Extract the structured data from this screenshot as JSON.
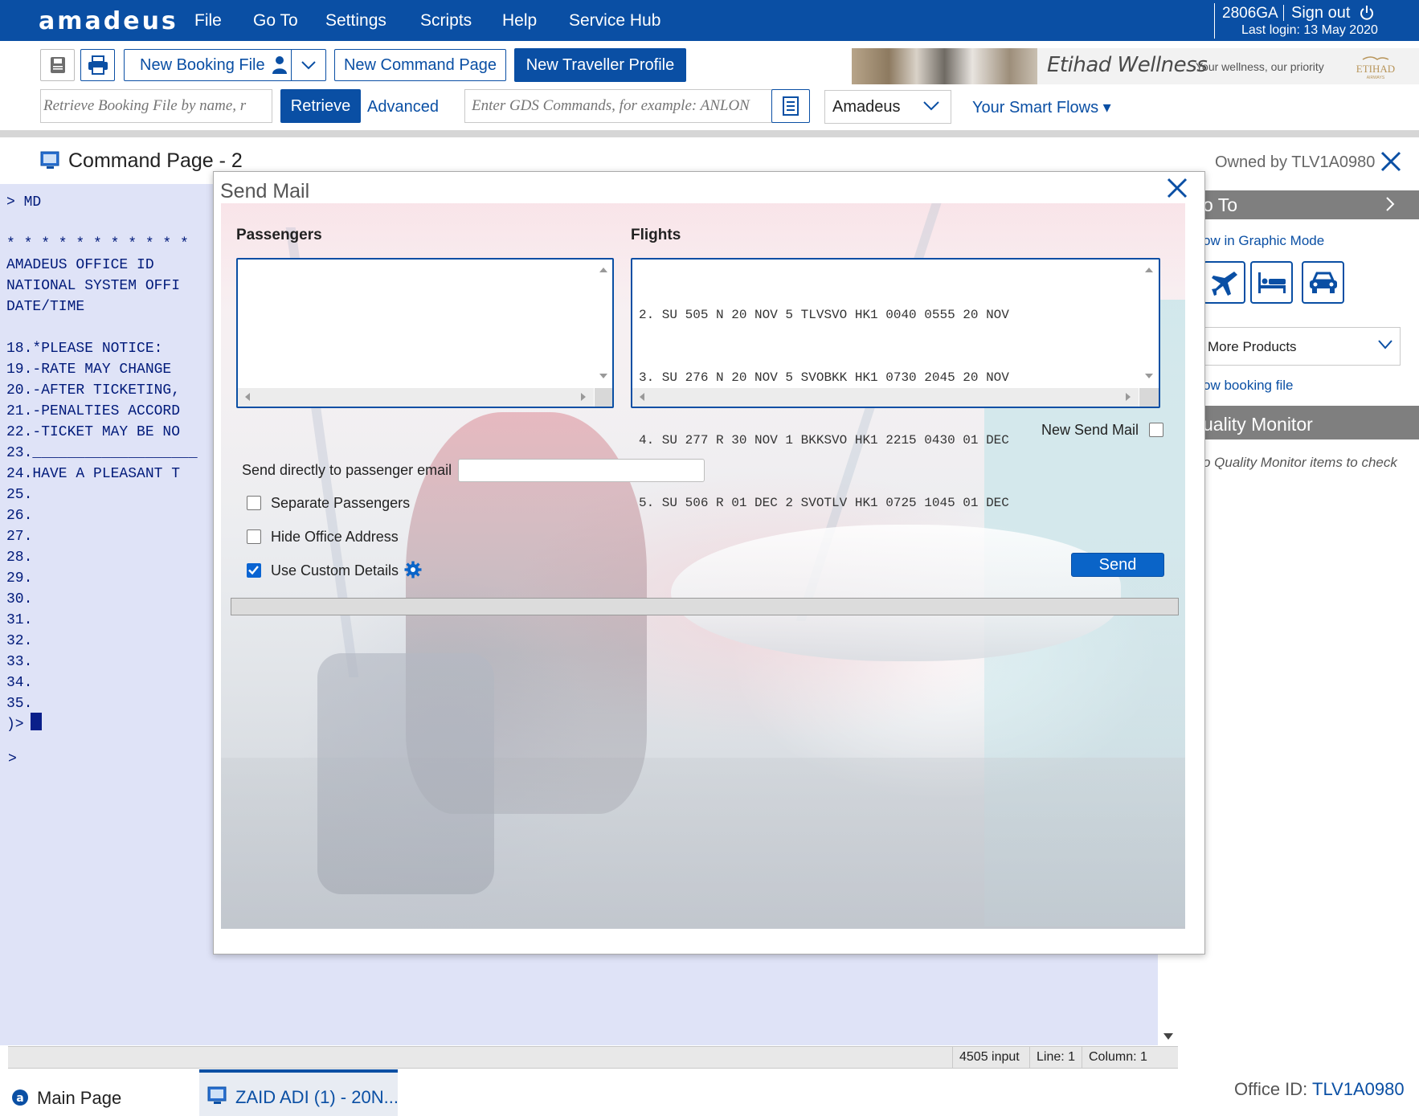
{
  "topbar": {
    "logo": "amadeus",
    "menu": [
      "File",
      "Go To",
      "Settings",
      "Scripts",
      "Help",
      "Service Hub"
    ],
    "user_code": "2806GA",
    "sign_out": "Sign out",
    "last_login": "Last login: 13 May 2020"
  },
  "toolbar": {
    "new_booking_file": "New Booking File",
    "new_command_page": "New Command Page",
    "new_traveller_profile": "New Traveller Profile",
    "retrieve_placeholder": "Retrieve Booking File by name, r",
    "retrieve_label": "Retrieve",
    "advanced_label": "Advanced",
    "gds_placeholder": "Enter GDS Commands, for example: ANLON",
    "gds_provider": "Amadeus",
    "smart_flows": "Your Smart Flows ▾"
  },
  "banner": {
    "title": "Etihad Wellness",
    "subtitle": "Your wellness, our priority",
    "logo_text": "ETIHAD",
    "logo_sub": "AIRWAYS"
  },
  "command_page": {
    "title": "Command Page - 2",
    "owned_by": "Owned by TLV1A0980"
  },
  "terminal": {
    "lines": "> MD\n\n* * * * * * * * * * *\nAMADEUS OFFICE ID\nNATIONAL SYSTEM OFFI\nDATE/TIME\n\n18.*PLEASE NOTICE:\n19.-RATE MAY CHANGE\n20.-AFTER TICKETING,\n21.-PENALTIES ACCORD\n22.-TICKET MAY BE NO\n23.___________________\n24.HAVE A PLEASANT T\n25.\n26.\n27.\n28.\n29.\n30.\n31.\n32.\n33.\n34.\n35.\n)>",
    "prompt2": ">"
  },
  "side_panel": {
    "goto": "o To",
    "graphic_mode": "ow in Graphic Mode",
    "more_products": "More Products",
    "show_booking_file": "ow booking file",
    "quality_monitor": "uality Monitor",
    "qm_empty": "o Quality Monitor items to check"
  },
  "status": {
    "input": "4505 input",
    "line": "Line: 1",
    "column": "Column: 1"
  },
  "tabs": {
    "main": "Main Page",
    "command": "ZAID ADI (1) - 20N..."
  },
  "office": {
    "label": "Office ID: ",
    "value": "TLV1A0980"
  },
  "modal": {
    "title": "Send Mail",
    "passengers_label": "Passengers",
    "flights_label": "Flights",
    "flights": [
      "2. SU 505 N 20 NOV 5 TLVSVO HK1 0040 0555 20 NOV",
      "3. SU 276 N 20 NOV 5 SVOBKK HK1 0730 2045 20 NOV",
      "4. SU 277 R 30 NOV 1 BKKSVO HK1 2215 0430 01 DEC",
      "5. SU 506 R 01 DEC 2 SVOTLV HK1 0725 1045 01 DEC"
    ],
    "new_send_mail": "New Send Mail",
    "new_send_mail_checked": false,
    "email_label": "Send directly to passenger email",
    "email_value": "",
    "separate_passengers": "Separate Passengers",
    "separate_passengers_checked": false,
    "hide_office_address": "Hide Office Address",
    "hide_office_address_checked": false,
    "use_custom_details": "Use Custom Details",
    "use_custom_details_checked": true,
    "send_label": "Send"
  },
  "colors": {
    "brand": "#0a4fa4",
    "terminal_bg": "#dfe3f7",
    "terminal_text": "#001a7a",
    "panel_header": "#7f7f7f"
  }
}
